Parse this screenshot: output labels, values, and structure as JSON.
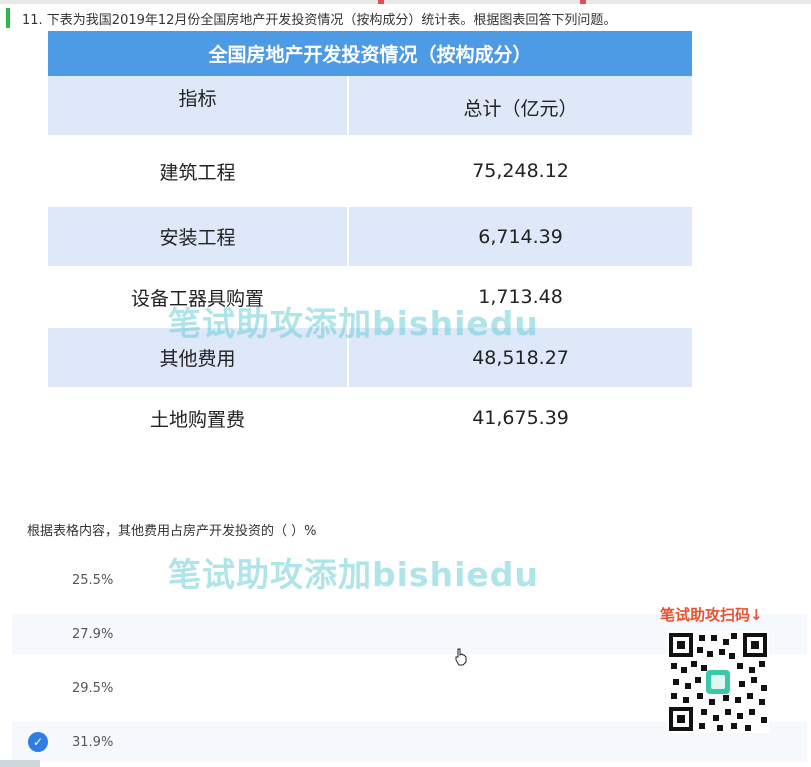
{
  "question": {
    "text": "11. 下表为我国2019年12月份全国房地产开发投资情况（按构成分）统计表。根据图表回答下列问题。"
  },
  "table": {
    "title": "全国房地产开发投资情况（按构成分）",
    "headers": [
      "指标",
      "总计（亿元）"
    ],
    "rows": [
      {
        "label": "建筑工程",
        "value": "75,248.12"
      },
      {
        "label": "安装工程",
        "value": "6,714.39"
      },
      {
        "label": "设备工器具购置",
        "value": "1,713.48"
      },
      {
        "label": "其他费用",
        "value": "48,518.27"
      },
      {
        "label": "土地购置费",
        "value": "41,675.39"
      }
    ]
  },
  "prompt": "根据表格内容，其他费用占房产开发投资的（ ）%",
  "options": [
    {
      "label": "25.5%",
      "selected": false
    },
    {
      "label": "27.9%",
      "selected": false
    },
    {
      "label": "29.5%",
      "selected": false
    },
    {
      "label": "31.9%",
      "selected": true
    }
  ],
  "watermark": "笔试助攻添加bishiedu",
  "qr": {
    "caption": "笔试助攻扫码↓"
  },
  "colors": {
    "header_blue": "#4d9be4",
    "row_shade": "#dfe8f8",
    "check_blue": "#2f7de0",
    "qr_caption": "#e8522f",
    "watermark": "#6ecdd7"
  }
}
